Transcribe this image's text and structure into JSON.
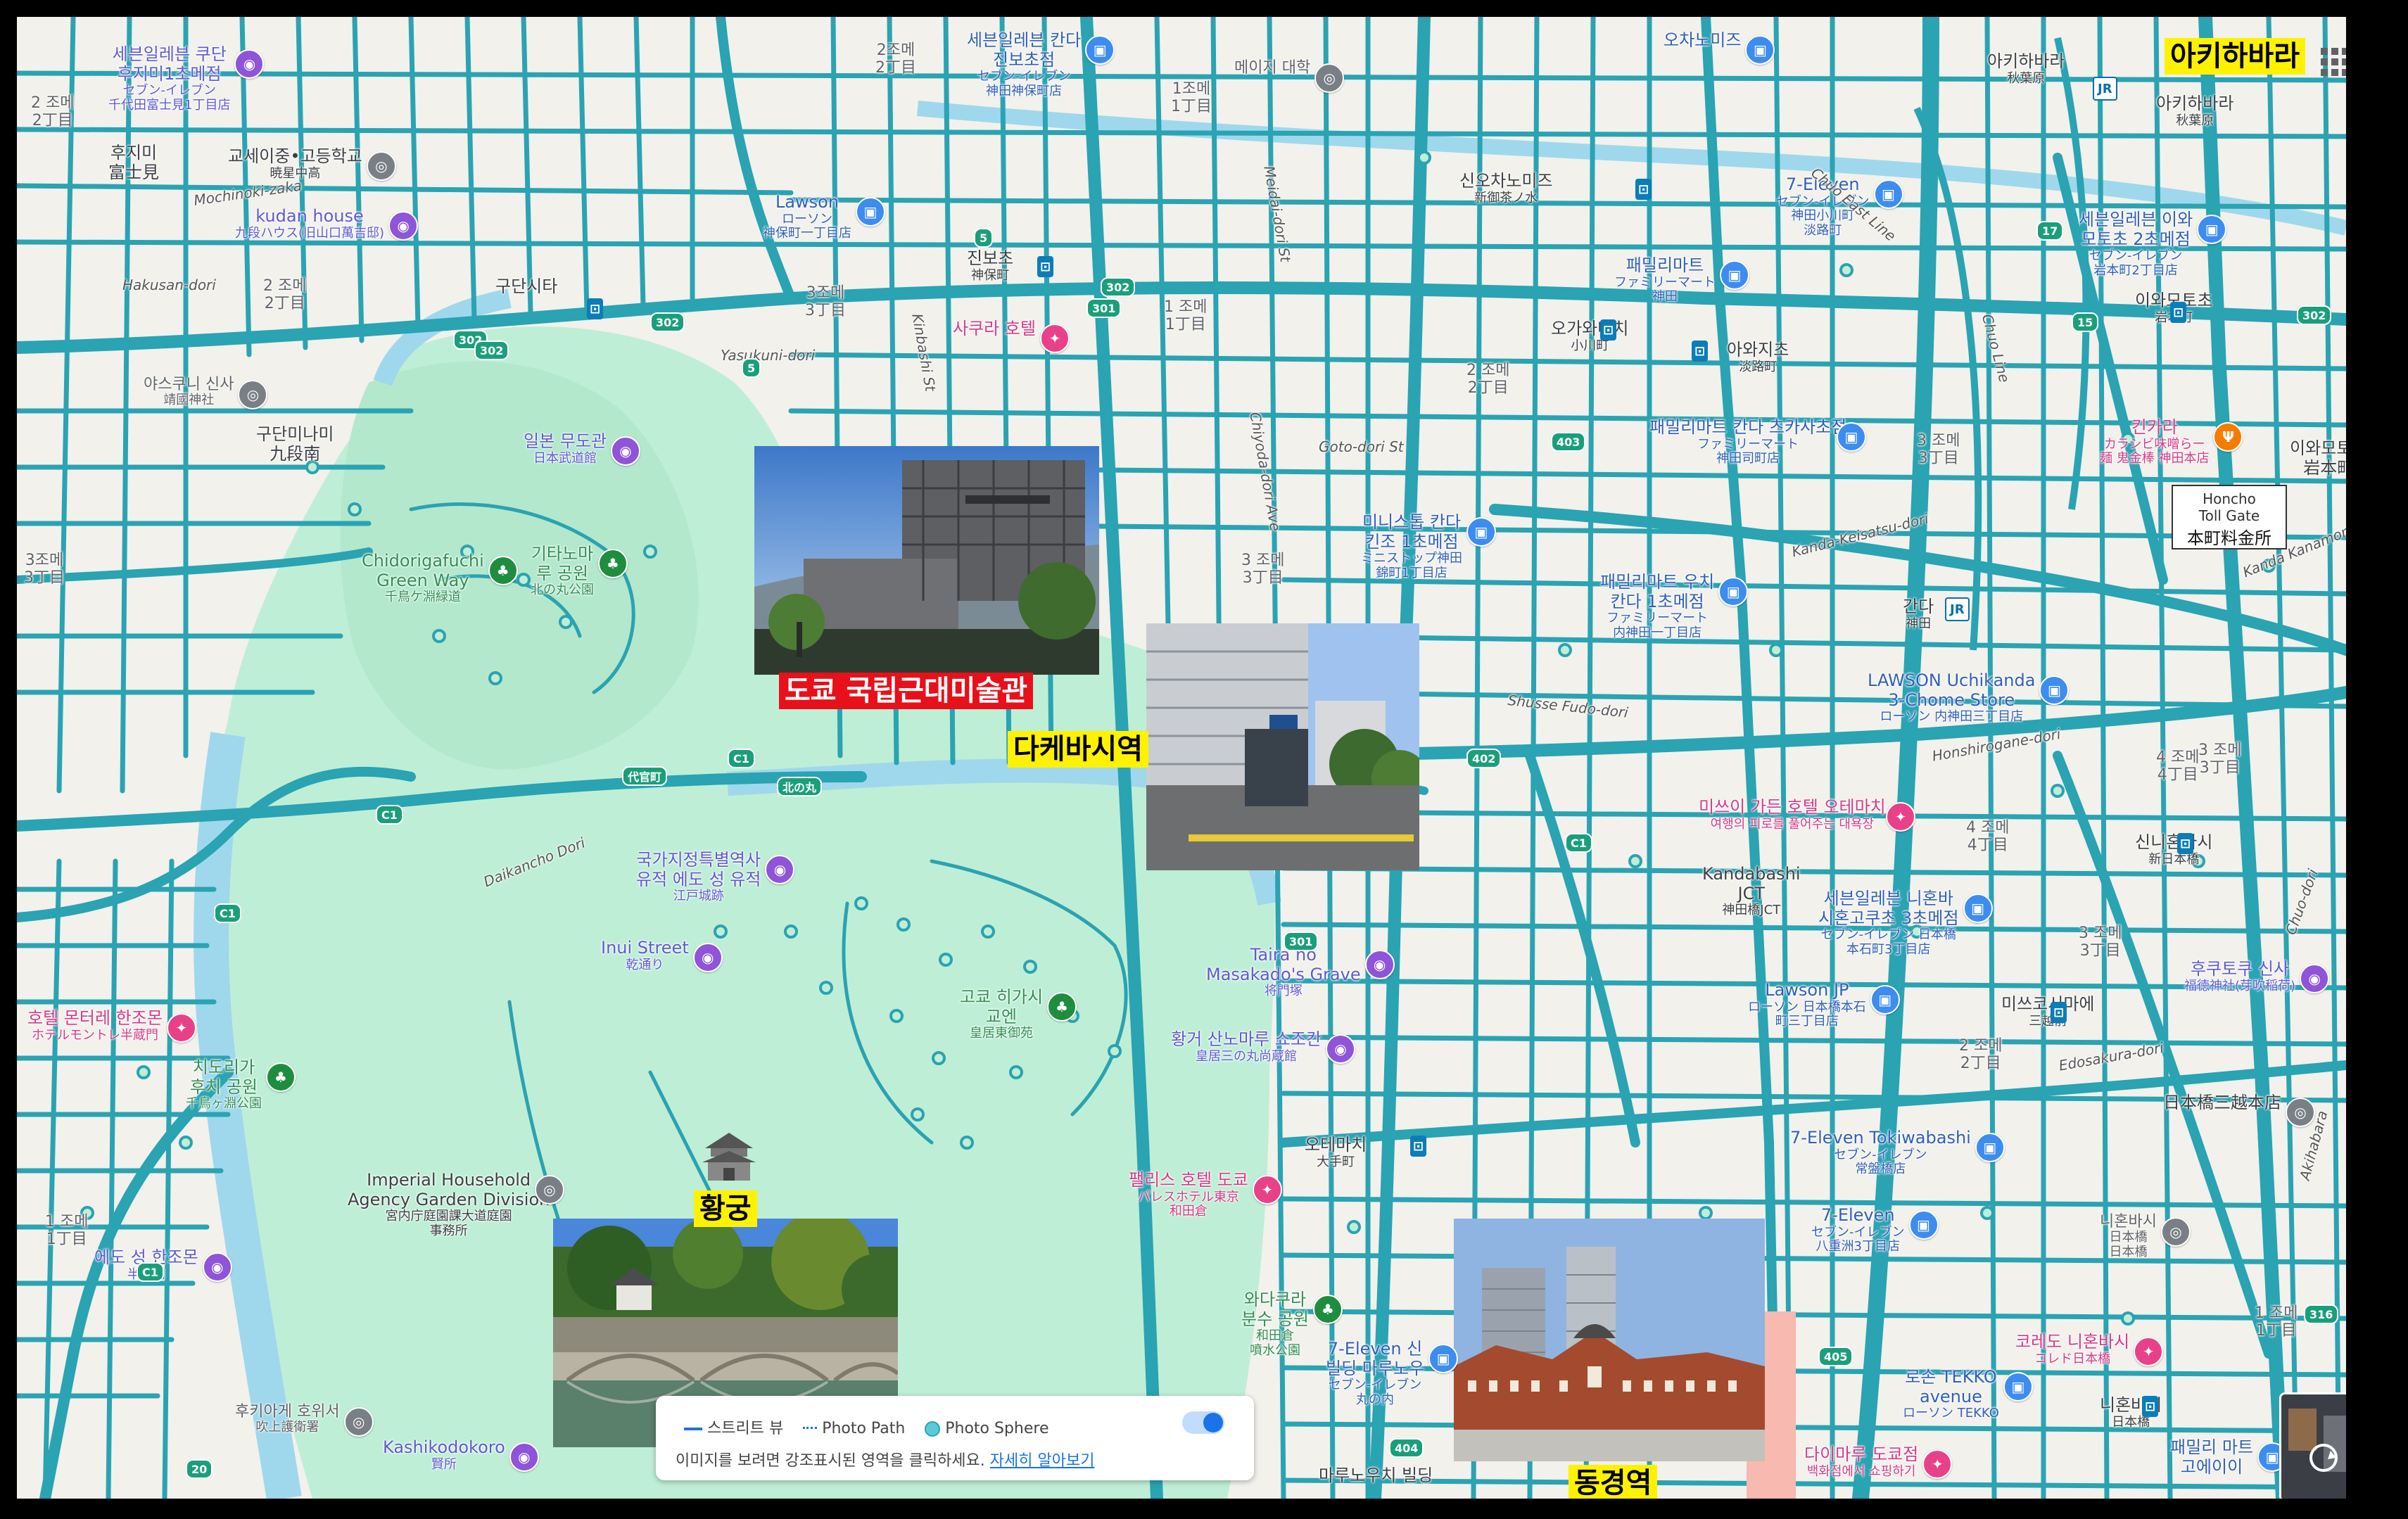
{
  "map": {
    "highlight_labels": {
      "akihabara": "아키하바라",
      "momat": "도쿄 국립근대미술관",
      "takebashi": "다케바시역",
      "imperial_palace": "황궁",
      "tokyo_station": "동경역"
    },
    "place_labels": [
      {
        "id": "seven-eleven-kudan",
        "text": "세븐일레븐 쿠단\n후지미1초메점",
        "sub": "セブン-イレブン\n千代田富士見1丁目店",
        "kind": "poi"
      },
      {
        "id": "fujimi-2",
        "text": "2 조메\n2丁目",
        "kind": "gray"
      },
      {
        "id": "fujimi",
        "text": "후지미\n富士見",
        "kind": "dark"
      },
      {
        "id": "gyosei",
        "text": "교세이중•고등학교",
        "sub": "暁星中高",
        "kind": "dark"
      },
      {
        "id": "kudan-house",
        "text": "kudan house",
        "sub": "九段ハウス(旧山口萬吉邸)",
        "kind": "poi"
      },
      {
        "id": "kudanshita",
        "text": "구단시타",
        "kind": "dark"
      },
      {
        "id": "kudan-2",
        "text": "2 조메\n2丁目",
        "kind": "gray"
      },
      {
        "id": "yasukuni",
        "text": "야스쿠니 신사",
        "sub": "靖國神社",
        "kind": "gray"
      },
      {
        "id": "kudanminami",
        "text": "구단미나미\n九段南",
        "kind": "dark"
      },
      {
        "id": "budokan",
        "text": "일본 무도관",
        "sub": "日本武道館",
        "kind": "poi"
      },
      {
        "id": "chidorigafuchi",
        "text": "Chidorigafuchi\nGreen Way",
        "sub": "千鳥ケ淵緑道",
        "kind": "green"
      },
      {
        "id": "kitanomaru",
        "text": "기타노마\n루 공원",
        "sub": "北の丸公園",
        "kind": "green"
      },
      {
        "id": "bancho-3",
        "text": "3조메\n3丁目",
        "kind": "gray"
      },
      {
        "id": "kokyo-higashi-gyoen",
        "text": "국가지정특별역사\n유적 에도 성 유적",
        "sub": "江戸城跡",
        "kind": "poi"
      },
      {
        "id": "inui",
        "text": "Inui Street",
        "sub": "乾通り",
        "kind": "poi"
      },
      {
        "id": "hotel-monterey",
        "text": "호텔 몬터레 한조몬",
        "sub": "ホテルモントレ半蔵門",
        "kind": "pink"
      },
      {
        "id": "chidori-park",
        "text": "치도리가\n후치 공원",
        "sub": "千鳥ヶ淵公園",
        "kind": "green"
      },
      {
        "id": "imperial-household",
        "text": "Imperial Household\nAgency Garden Division",
        "sub": "宮内庁庭園課大道庭園\n事務所",
        "kind": "dark"
      },
      {
        "id": "hanzomon",
        "text": "에도 성 한조몬",
        "sub": "半蔵門",
        "kind": "poi"
      },
      {
        "id": "kojimachi-1",
        "text": "1 조메\n1丁目",
        "kind": "gray"
      },
      {
        "id": "kokyo-higashi",
        "text": "고쿄 히가시\n교엔",
        "sub": "皇居東御苑",
        "kind": "green"
      },
      {
        "id": "taira",
        "text": "Taira no\nMasakado's Grave",
        "sub": "将門塚",
        "kind": "poi"
      },
      {
        "id": "sannomaru",
        "text": "황거 산노마루 쇼조칸",
        "sub": "皇居三の丸尚蔵館",
        "kind": "poi"
      },
      {
        "id": "palace-hotel",
        "text": "팰리스 호텔 도쿄",
        "sub": "パレスホテル東京\n和田倉",
        "kind": "pink"
      },
      {
        "id": "otemachi",
        "text": "오테마치",
        "sub": "大手町",
        "kind": "dark"
      },
      {
        "id": "wadakura",
        "text": "와다쿠라\n분수 공원",
        "sub": "和田倉\n噴水公園",
        "kind": "green"
      },
      {
        "id": "seven-eleven-building",
        "text": "7-Eleven 신\n빌딩 마루노우\n",
        "sub": "セブン-イレブン\n丸の内",
        "kind": "blue"
      },
      {
        "id": "kokyo-gaien",
        "text": "후키아게 호위서",
        "sub": "吹上護衛署",
        "kind": "gray"
      },
      {
        "id": "kashikodokoro",
        "text": "Kashikodokoro",
        "sub": "賢所",
        "kind": "poi"
      },
      {
        "id": "jinbocho",
        "text": "진보초",
        "sub": "神保町",
        "kind": "dark"
      },
      {
        "id": "jinbocho-2",
        "text": "2조메\n2丁目",
        "kind": "gray"
      },
      {
        "id": "jinbocho-3",
        "text": "3조메\n3丁目",
        "kind": "gray"
      },
      {
        "id": "jinbocho-1",
        "text": "1 조메\n1丁目",
        "kind": "gray"
      },
      {
        "id": "sakura-bookstore",
        "text": "사쿠라 호텔",
        "sub": "",
        "kind": "pink"
      },
      {
        "id": "kanda-1",
        "text": "1조메\n1丁目",
        "kind": "gray"
      },
      {
        "id": "seven-jinbocho",
        "text": "세븐일레븐 칸다\n진보초점",
        "sub": "セブン-イレブン\n神田神保町店",
        "kind": "blue"
      },
      {
        "id": "lawson-jinbocho",
        "text": "Lawson",
        "sub": "ローソン\n神保町一丁目店",
        "kind": "blue"
      },
      {
        "id": "meiji-univ",
        "text": "메이지 대학",
        "sub": "",
        "kind": "gray"
      },
      {
        "id": "surugadai",
        "text": "오차노미즈",
        "sub": "",
        "kind": "blue"
      },
      {
        "id": "shin-ochanomizu",
        "text": "신오차노미즈",
        "sub": "新御茶ノ水",
        "kind": "dark"
      },
      {
        "id": "seven-ogawamachi",
        "text": "7-Eleven",
        "sub": "セブン-イレブン\n神田小川町\n淡路町",
        "kind": "blue"
      },
      {
        "id": "familymart-kanda",
        "text": "패밀리마트",
        "sub": "ファミリーマート\n神田",
        "kind": "blue"
      },
      {
        "id": "ogawamachi",
        "text": "오가와마치",
        "sub": "小川町",
        "kind": "dark"
      },
      {
        "id": "awajicho",
        "text": "아와지초",
        "sub": "淡路町",
        "kind": "dark"
      },
      {
        "id": "familymart-tsukasa",
        "text": "패밀리마트 칸다 츠카사초점",
        "sub": "ファミリーマート\n神田司町店",
        "kind": "blue"
      },
      {
        "id": "kanda-2",
        "text": "2 조메\n2丁目",
        "kind": "gray"
      },
      {
        "id": "kanda-3",
        "text": "3 조메\n3丁目",
        "kind": "gray"
      },
      {
        "id": "ministop",
        "text": "미니스톱 칸다\n킨조 1초메점",
        "sub": "ミニストップ神田\n錦町1丁目店",
        "kind": "blue"
      },
      {
        "id": "nishikicho-3",
        "text": "3 조메\n3丁目",
        "kind": "gray"
      },
      {
        "id": "familymart-kanda2",
        "text": "패밀리마트 우치\n칸다 1초메점",
        "sub": "ファミリーマート\n内神田一丁目店",
        "kind": "blue"
      },
      {
        "id": "kanda",
        "text": "간다",
        "sub": "神田",
        "kind": "dark"
      },
      {
        "id": "lawson-uchikanda",
        "text": "LAWSON Uchikanda\n3-Chome Store",
        "sub": "ローソン 内神田三丁目店",
        "kind": "blue"
      },
      {
        "id": "kinkara",
        "text": "킨카라",
        "sub": "カラシビ味噌らー\n麺 鬼金棒 神田本店",
        "kind": "orange"
      },
      {
        "id": "iwamotocho-3",
        "text": "3 조메\n3丁目",
        "kind": "gray"
      },
      {
        "id": "iwamotocho",
        "text": "이와모토초\n岩本町",
        "kind": "dark"
      },
      {
        "id": "iwamotocho2",
        "text": "이와모토초",
        "sub": "岩本町",
        "kind": "dark"
      },
      {
        "id": "akihabara-jr",
        "text": "아키하바라",
        "sub": "秋葉原",
        "kind": "dark"
      },
      {
        "id": "akihabara-jr2",
        "text": "아키하바라",
        "sub": "秋葉原",
        "kind": "dark"
      },
      {
        "id": "seven-iwamotocho",
        "text": "세븐일레븐 이와\n모토초 2초메점",
        "sub": "セブン-イレブン\n岩本町2丁目店",
        "kind": "blue"
      },
      {
        "id": "mitsui-garden",
        "text": "미쓰이 가든 호텔 오테마치",
        "sub": "여행의 피로를 풀어주는 대욕장",
        "kind": "pink"
      },
      {
        "id": "kandabashi",
        "text": "Kandabashi\nJCT",
        "sub": "神田橋JCT",
        "kind": "dark"
      },
      {
        "id": "seven-nihonbashi",
        "text": "세븐일레븐 니혼바\n시혼고쿠초 3초메점",
        "sub": "セブン-イレブン 日本橋\n本石町3丁目店",
        "kind": "blue"
      },
      {
        "id": "lawson-jp",
        "text": "Lawson JP",
        "sub": "ローソン 日本橋本石\n町三丁目店",
        "kind": "blue"
      },
      {
        "id": "shin-nihonbashi",
        "text": "신니혼바시",
        "sub": "新日本橋",
        "kind": "dark"
      },
      {
        "id": "muromachi-4",
        "text": "4 조메\n4丁目",
        "kind": "gray"
      },
      {
        "id": "muromachi-4b",
        "text": "4 조메\n4丁目",
        "kind": "gray"
      },
      {
        "id": "muromachi-3",
        "text": "3 조메\n3丁目",
        "kind": "gray"
      },
      {
        "id": "fukutoku",
        "text": "후쿠토쿠 신사",
        "sub": "福徳神社(芽吹稲荷)",
        "kind": "poi"
      },
      {
        "id": "mitsukoshimae",
        "text": "미쓰코시마에",
        "sub": "三越前",
        "kind": "dark"
      },
      {
        "id": "muromachi-2",
        "text": "2 조메\n2丁目",
        "kind": "gray"
      },
      {
        "id": "mitsukoshi",
        "text": "日本橋三越本店",
        "sub": "",
        "kind": "dark"
      },
      {
        "id": "seven-tokiwabashi",
        "text": "7-Eleven Tokiwabashi",
        "sub": "セブン-イレブン\n常盤橋店",
        "kind": "blue"
      },
      {
        "id": "seven-yaesu",
        "text": "7-Eleven",
        "sub": "セブン-イレブン\n八重洲3丁目店",
        "kind": "blue"
      },
      {
        "id": "nihonbashi-bridge",
        "text": "니혼바시",
        "sub": "日本橋\n日本橋",
        "kind": "gray"
      },
      {
        "id": "coredo",
        "text": "코레도 니혼바시",
        "sub": "コレド日本橋",
        "kind": "pink"
      },
      {
        "id": "nihonbashi",
        "text": "니혼바시",
        "sub": "日本橋",
        "kind": "dark"
      },
      {
        "id": "nihonbashi-1",
        "text": "1 조메\n1丁目",
        "kind": "gray"
      },
      {
        "id": "lawson-tekko",
        "text": "로손 TEKKO\navenue",
        "sub": "ローソン TEKKO",
        "kind": "blue"
      },
      {
        "id": "familymart-ekimae",
        "text": "패밀리 마트\n고에이이",
        "sub": "",
        "kind": "blue"
      },
      {
        "id": "daimaru",
        "text": "다이마루 도쿄점",
        "sub": "백화점에서 쇼핑하기",
        "kind": "pink"
      },
      {
        "id": "marunouchi",
        "text": "마루노우치 빌딩",
        "sub": "",
        "kind": "dark"
      },
      {
        "id": "honcho-toll",
        "text": "Honcho\nToll Gate",
        "sub": "本町料金所",
        "kind": "dark"
      }
    ],
    "road_labels": [
      "Mochinoki-zaka",
      "Hakusan-dori",
      "Yasukuni-dori",
      "Kinbashi St",
      "Meidai-dori St",
      "Chiyoda-dori Ave",
      "Goto-dori St",
      "Kanda-Keisatsu-dori",
      "Chuo East Line",
      "Chuo Line",
      "Kanda Kanamono-dori",
      "Daikancho Dori",
      "Shusse Fudo-dori",
      "Honshirogane-dori",
      "Edosakura-dori",
      "Akihabara",
      "Chuo-dori"
    ],
    "route_shields": [
      "302",
      "302",
      "302",
      "301",
      "5",
      "403",
      "402",
      "17",
      "405",
      "404",
      "316",
      "C1",
      "C1",
      "C1",
      "C1",
      "C1",
      "301",
      "20",
      "5",
      "15",
      "302",
      "302"
    ],
    "gate_labels": [
      "代官町",
      "北の丸"
    ],
    "stations": [
      "구단시타",
      "진보초",
      "오가와마치",
      "신오차노미즈",
      "아와지초",
      "간다",
      "오테마치",
      "니혼바시",
      "미쓰코시마에",
      "아키하바라",
      "신니혼바시",
      "이와모토초"
    ],
    "toll_gate": {
      "en": "Honcho\nToll Gate",
      "ja": "本町料金所"
    },
    "colors": {
      "road": "#2aa3b2",
      "park": "#bfeed6",
      "land": "#f4f3ef",
      "block": "#efece4",
      "highlight_yellow": "#fff200",
      "highlight_red": "#e8101a"
    }
  },
  "street_view_panel": {
    "legend_street": "스트리트 뷰",
    "legend_path": "Photo Path",
    "legend_sphere": "Photo Sphere",
    "hint": "이미지를 보려면 강조표시된 영역을 클릭하세요.",
    "learn_more": "자세히 알아보기"
  }
}
